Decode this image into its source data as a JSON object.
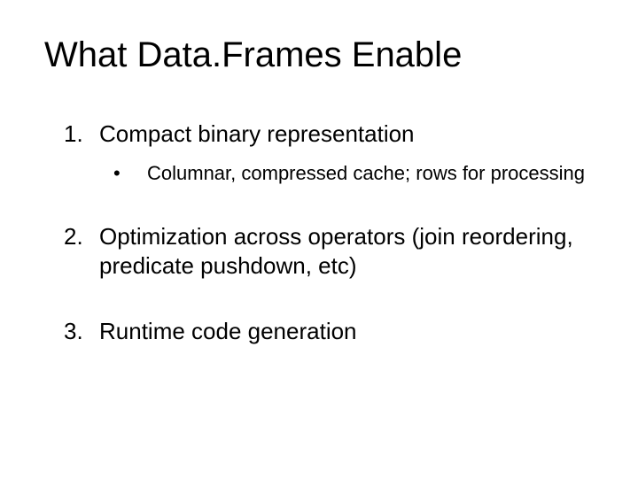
{
  "title": "What Data.Frames Enable",
  "items": [
    {
      "text": "Compact binary representation",
      "sub": [
        {
          "text": "Columnar, compressed cache; rows for processing"
        }
      ]
    },
    {
      "text": "Optimization across operators (join reordering, predicate pushdown, etc)",
      "sub": []
    },
    {
      "text": "Runtime code generation",
      "sub": []
    }
  ]
}
